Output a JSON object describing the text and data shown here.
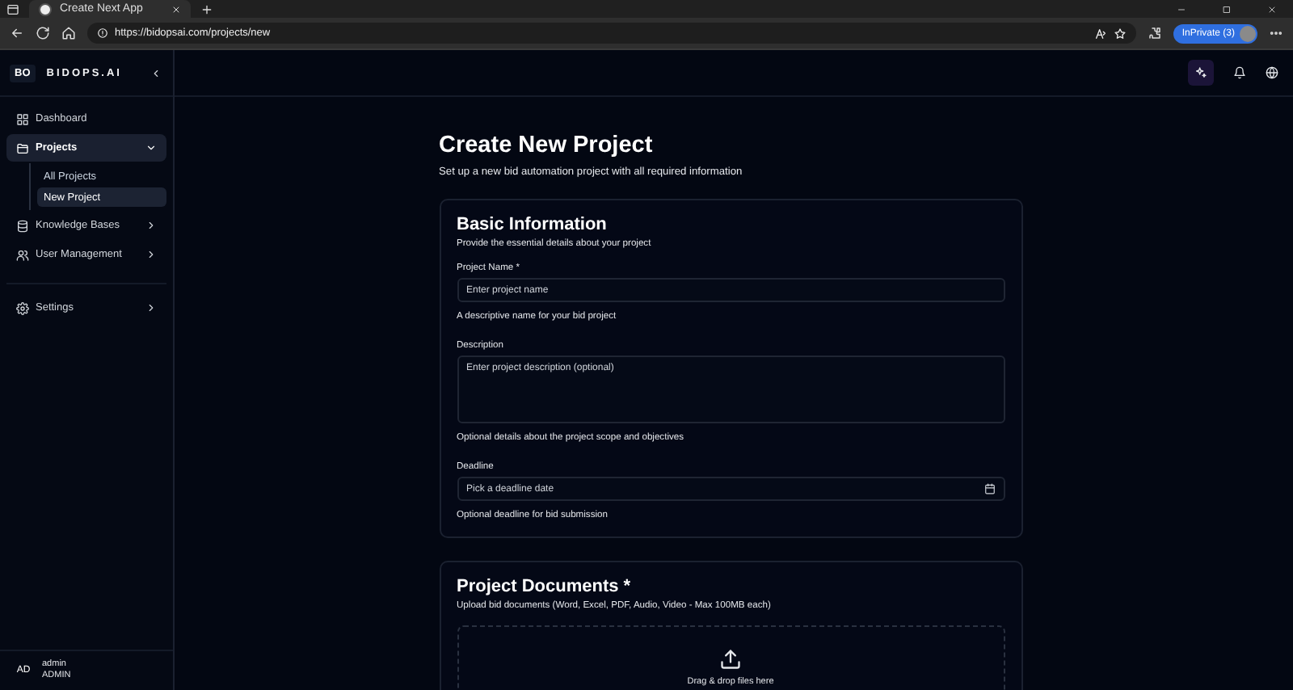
{
  "browser": {
    "tab_title": "Create Next App",
    "url": "https://bidopsai.com/projects/new",
    "inprivate_badge": "InPrivate (3)"
  },
  "sidebar": {
    "logo_mark": "BO",
    "brand": "BIDOPS.AI",
    "items": [
      {
        "label": "Dashboard",
        "kind": "link",
        "selected": false
      },
      {
        "label": "Projects",
        "kind": "group",
        "selected": true,
        "expanded": true,
        "children": [
          {
            "label": "All Projects",
            "selected": false
          },
          {
            "label": "New Project",
            "selected": true
          }
        ]
      },
      {
        "label": "Knowledge Bases",
        "kind": "group",
        "selected": false,
        "expanded": false
      },
      {
        "label": "User Management",
        "kind": "group",
        "selected": false,
        "expanded": false
      }
    ],
    "bottom_items": [
      {
        "label": "Settings",
        "kind": "group",
        "selected": false,
        "expanded": false
      }
    ],
    "user": {
      "initials": "AD",
      "name": "admin",
      "role": "ADMIN"
    }
  },
  "page": {
    "title": "Create New Project",
    "subtitle": "Set up a new bid automation project with all required information"
  },
  "basic_information": {
    "title": "Basic Information",
    "description": "Provide the essential details about your project",
    "fields": [
      {
        "kind": "input",
        "label": "Project Name *",
        "placeholder": "Enter project name",
        "help": "A descriptive name for your bid project"
      },
      {
        "kind": "textarea",
        "label": "Description",
        "placeholder": "Enter project description (optional)",
        "help": "Optional details about the project scope and objectives"
      },
      {
        "kind": "date",
        "label": "Deadline",
        "placeholder": "Pick a deadline date",
        "help": "Optional deadline for bid submission"
      }
    ]
  },
  "project_documents": {
    "title": "Project Documents *",
    "description": "Upload bid documents (Word, Excel, PDF, Audio, Video - Max 100MB each)",
    "dropzone_text": "Drag & drop files here"
  }
}
